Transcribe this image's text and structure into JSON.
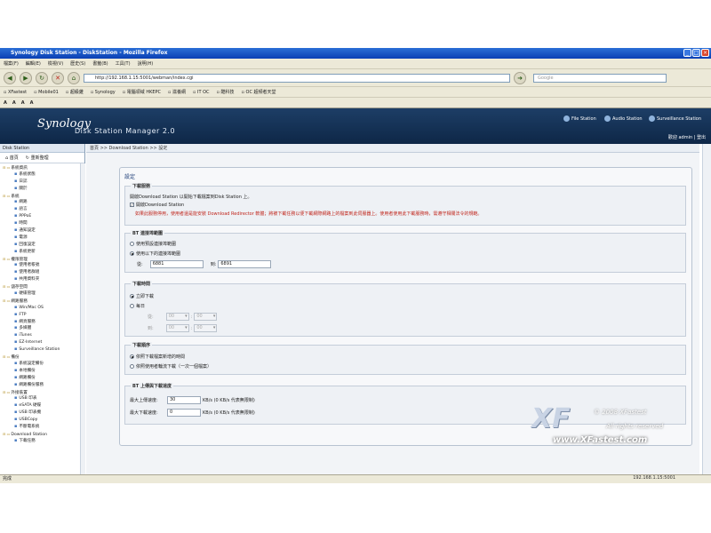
{
  "window": {
    "title": "Synology Disk Station - DiskStation - Mozilla Firefox"
  },
  "menu": [
    "檔案(F)",
    "編輯(E)",
    "檢視(V)",
    "歷史(S)",
    "書籤(B)",
    "工具(T)",
    "說明(H)"
  ],
  "nav": {
    "url": "http://192.168.1.15:5001/webman/index.cgi",
    "search_placeholder": "Google"
  },
  "bookmarks": [
    "XFastest",
    "Mobile01",
    "超級雞",
    "Synology",
    "電腦領域 HKEPC",
    "滋養網",
    "IT OC",
    "酷科技",
    "OC 超頻者天堂"
  ],
  "toolbar2": [
    "A",
    "A",
    "A",
    "A"
  ],
  "header": {
    "logo": "Synology",
    "logo_sub": "Disk Station Manager 2.0",
    "stations": [
      "File Station",
      "Audio Station",
      "Surveillance Station"
    ],
    "user_links": "歡迎 admin | 登出"
  },
  "sidebar": {
    "title": "Disk Station",
    "home": "首頁",
    "refresh": "重新整理",
    "tree": [
      {
        "t": "grp",
        "label": "系統資訊"
      },
      {
        "t": "it",
        "label": "系統狀態"
      },
      {
        "t": "it",
        "label": "日誌"
      },
      {
        "t": "it",
        "label": "關於"
      },
      {
        "t": "grp",
        "label": "系統"
      },
      {
        "t": "it",
        "label": "網路"
      },
      {
        "t": "it",
        "label": "語言"
      },
      {
        "t": "it",
        "label": "PPPoE"
      },
      {
        "t": "it",
        "label": "時間"
      },
      {
        "t": "it",
        "label": "通知設定"
      },
      {
        "t": "it",
        "label": "電源"
      },
      {
        "t": "it",
        "label": "回復設定"
      },
      {
        "t": "it",
        "label": "系統更新"
      },
      {
        "t": "grp",
        "label": "權限管理"
      },
      {
        "t": "it",
        "label": "使用者帳號"
      },
      {
        "t": "it",
        "label": "使用者群組"
      },
      {
        "t": "it",
        "label": "共用資料夾"
      },
      {
        "t": "grp",
        "label": "儲存空間"
      },
      {
        "t": "it",
        "label": "硬碟管理"
      },
      {
        "t": "grp",
        "label": "網路服務"
      },
      {
        "t": "it",
        "label": "Win/Mac OS"
      },
      {
        "t": "it",
        "label": "FTP"
      },
      {
        "t": "it",
        "label": "網頁服務"
      },
      {
        "t": "it",
        "label": "多媒體"
      },
      {
        "t": "it",
        "label": "iTunes"
      },
      {
        "t": "it",
        "label": "EZ-Internet"
      },
      {
        "t": "it",
        "label": "Surveillance Station"
      },
      {
        "t": "grp",
        "label": "備份"
      },
      {
        "t": "it",
        "label": "系統設定備份"
      },
      {
        "t": "it",
        "label": "本地備份"
      },
      {
        "t": "it",
        "label": "網路備份"
      },
      {
        "t": "it",
        "label": "網路備份服務"
      },
      {
        "t": "grp",
        "label": "外接裝置"
      },
      {
        "t": "it",
        "label": "USB 印表"
      },
      {
        "t": "it",
        "label": "eSATA 硬碟"
      },
      {
        "t": "it",
        "label": "USB 印表機"
      },
      {
        "t": "it",
        "label": "USBCopy"
      },
      {
        "t": "it",
        "label": "不斷電系統"
      },
      {
        "t": "grp",
        "label": "Download Station"
      },
      {
        "t": "it",
        "label": "下載任務"
      }
    ]
  },
  "breadcrumb": "首頁 >> Download Station >> 設定",
  "settings": {
    "title": "設定",
    "dl_service": {
      "legend": "下載服務",
      "desc": "開啟Download Station 以開始下載檔案到Disk Station 上。",
      "enable_label": "開啟Download Station",
      "warning": "如果此服務停用，使用者還是能安裝 Download Redirector 軟體；將被下載任務以便下載網際網路上的檔案到此伺服器上。使用者使用此下載服務時，需遵守相關法令的規範。"
    },
    "bt_ports": {
      "legend": "BT 連接埠範圍",
      "opt_default": "使用預設連接埠範圍",
      "opt_custom": "使用以下的連接埠範圍",
      "from_label": "從:",
      "from_value": "6881",
      "to_label": "到:",
      "to_value": "6891"
    },
    "schedule": {
      "legend": "下載時間",
      "opt_now": "立即下載",
      "opt_daily": "每日",
      "from_label": "從:",
      "to_label": "到:",
      "hour_val": "00",
      "min_val": "00",
      "colon": ":"
    },
    "order": {
      "legend": "下載順序",
      "opt_time": "依照下載檔案新增的時間",
      "opt_turn": "依照使用者輪流下載（一次一個檔案）"
    },
    "speed": {
      "legend": "BT 上傳與下載速度",
      "up_label": "最大上傳速度:",
      "up_value": "30",
      "down_label": "最大下載速度:",
      "down_value": "0",
      "unit_note": "KB/s (0 KB/s 代表無限制)"
    }
  },
  "watermark": {
    "big": "XF",
    "copyright": "© 2008 XFastest",
    "rights": "All rights reserved",
    "site": "www.XFastest.com"
  },
  "status": {
    "left": "完成",
    "right": "192.168.1.15:5001"
  }
}
